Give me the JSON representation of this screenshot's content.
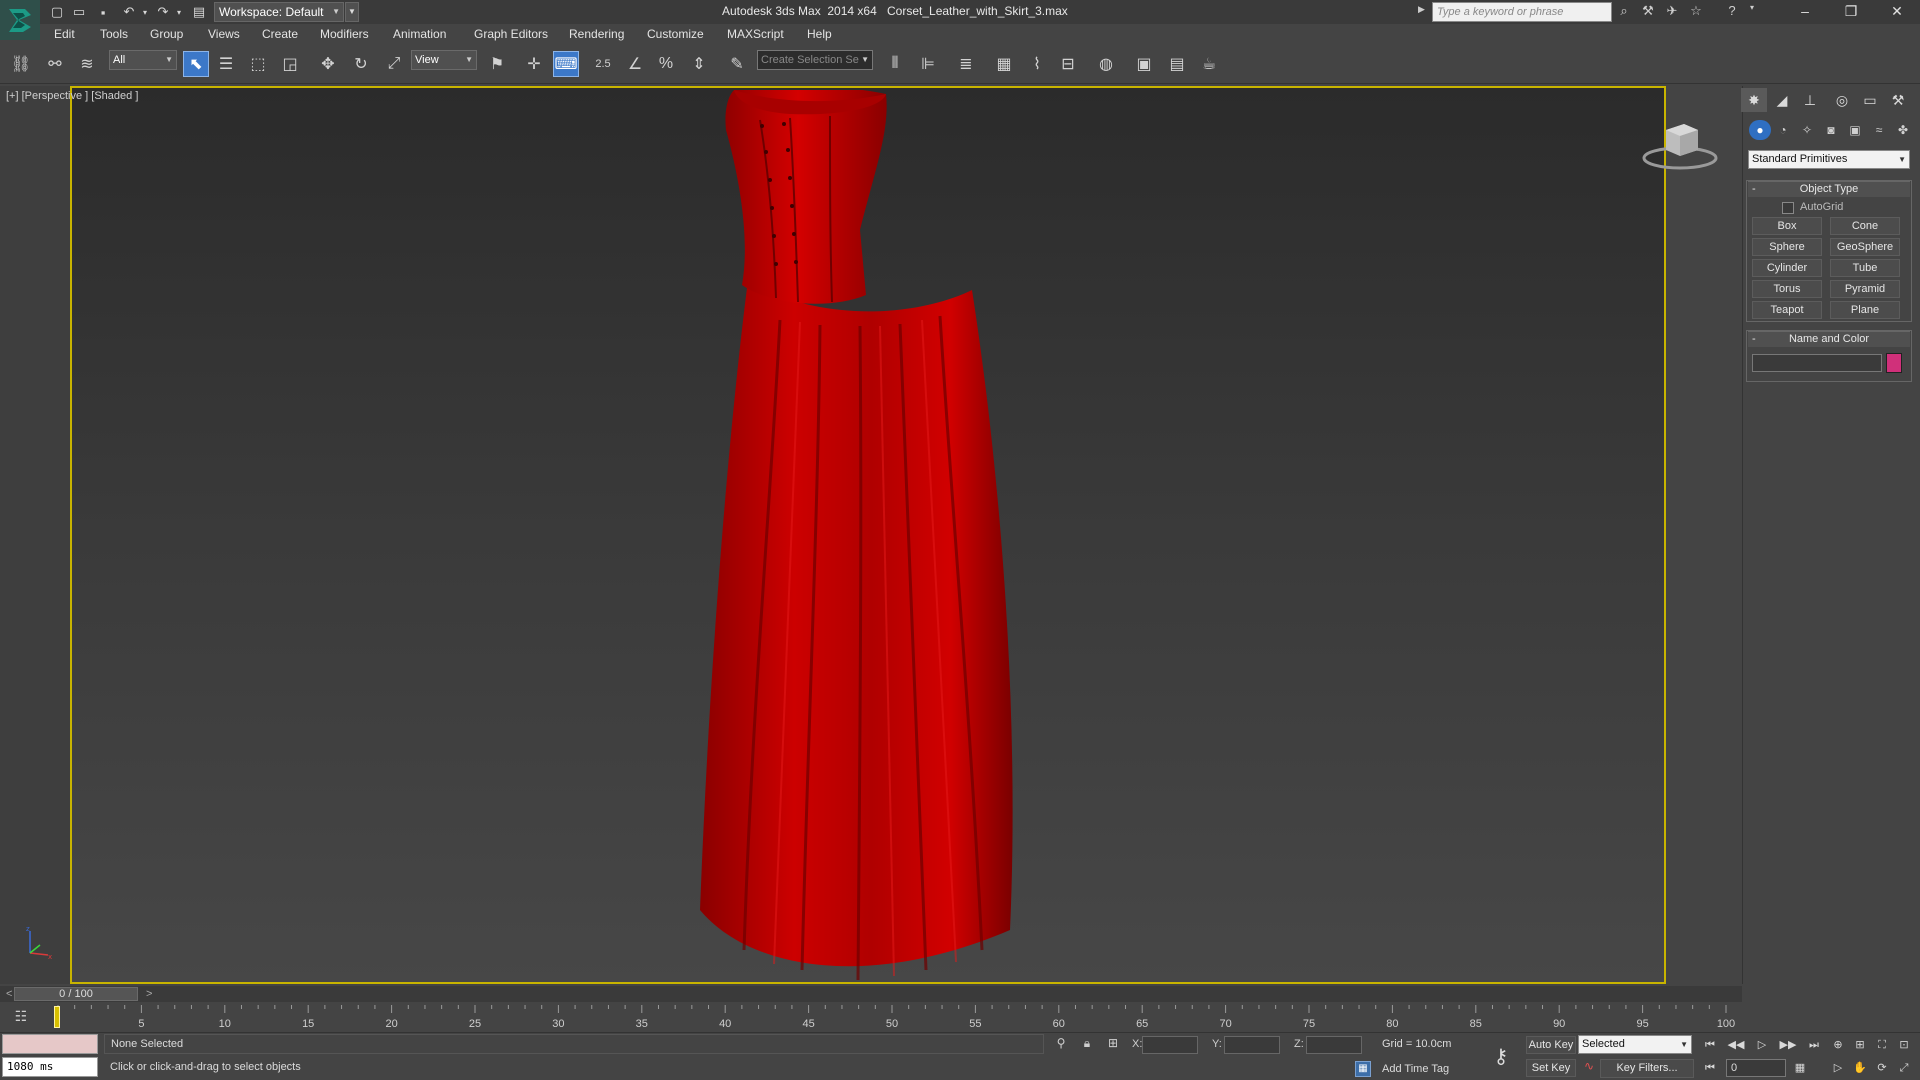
{
  "window": {
    "app_title": "Autodesk 3ds Max  2014 x64",
    "file_name": "Corset_Leather_with_Skirt_3.max",
    "workspace": "Workspace: Default",
    "search_placeholder": "Type a keyword or phrase"
  },
  "menu": [
    "Edit",
    "Tools",
    "Group",
    "Views",
    "Create",
    "Modifiers",
    "Animation",
    "Graph Editors",
    "Rendering",
    "Customize",
    "MAXScript",
    "Help"
  ],
  "toolbar": {
    "selection_filter": "All",
    "ref_coord": "View",
    "snap_25": "2.5",
    "named_selection_placeholder": "Create Selection Se"
  },
  "viewport": {
    "label": "[+] [Perspective ] [Shaded ]",
    "dress_color": "#c40000"
  },
  "command_panel": {
    "category": "Standard Primitives",
    "object_type_title": "Object Type",
    "autogrid_label": "AutoGrid",
    "primitives": [
      "Box",
      "Cone",
      "Sphere",
      "GeoSphere",
      "Cylinder",
      "Tube",
      "Torus",
      "Pyramid",
      "Teapot",
      "Plane"
    ],
    "name_color_title": "Name and Color",
    "swatch_color": "#d0307a"
  },
  "timeline": {
    "slider_left": "<",
    "slider_thumb": "0 / 100",
    "slider_right": ">",
    "ruler_labels": [
      "5",
      "10",
      "15",
      "20",
      "25",
      "30",
      "35",
      "40",
      "45",
      "50",
      "55",
      "60",
      "65",
      "70",
      "75",
      "80",
      "85",
      "90",
      "95",
      "100"
    ]
  },
  "status": {
    "selection": "None Selected",
    "prompt": "Click or click-and-drag to select objects",
    "time_ms": "1080 ms",
    "x_label": "X:",
    "y_label": "Y:",
    "z_label": "Z:",
    "grid": "Grid = 10.0cm",
    "add_time_tag": "Add Time Tag",
    "auto_key": "Auto Key",
    "set_key": "Set Key",
    "key_mode": "Selected",
    "key_filters": "Key Filters...",
    "current_frame": "0"
  }
}
